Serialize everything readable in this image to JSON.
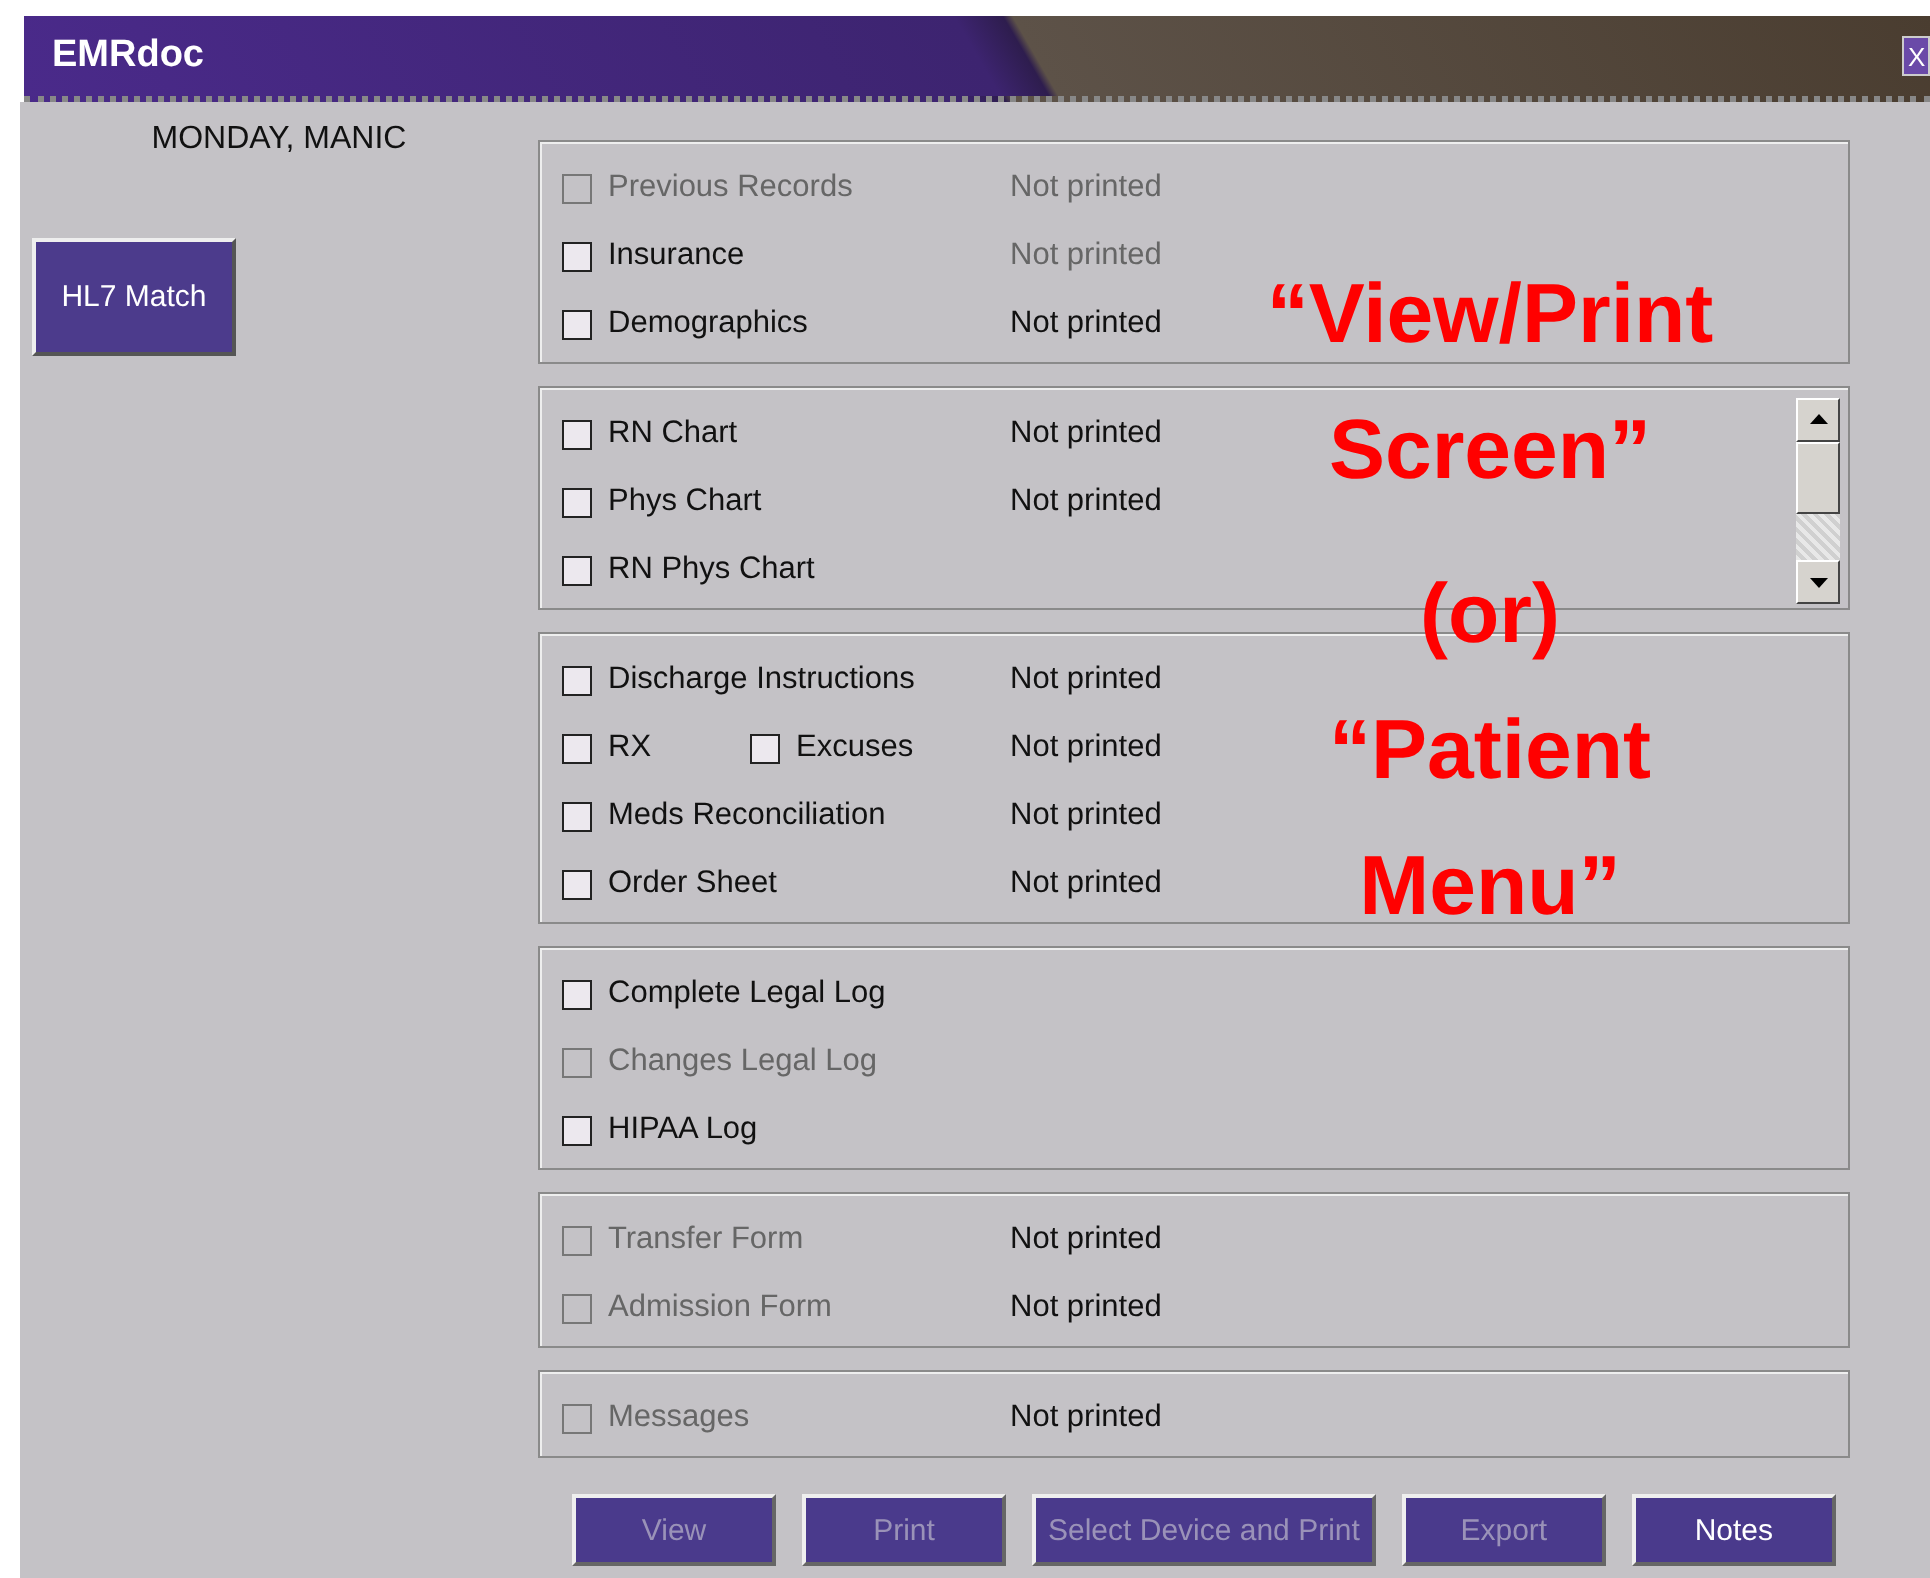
{
  "window": {
    "title": "EMRdoc",
    "close": "X"
  },
  "patient": "MONDAY, MANIC",
  "hl7_button": "HL7 Match",
  "groups": [
    {
      "scroll": false,
      "rows": [
        {
          "items": [
            {
              "label": "Previous Records",
              "checked": false,
              "disabled": true
            }
          ],
          "status": {
            "text": "Not printed",
            "disabled": true
          }
        },
        {
          "items": [
            {
              "label": "Insurance",
              "checked": false,
              "disabled": false
            }
          ],
          "status": {
            "text": "Not printed",
            "disabled": true
          }
        },
        {
          "items": [
            {
              "label": "Demographics",
              "checked": false,
              "disabled": false
            }
          ],
          "status": {
            "text": "Not printed",
            "disabled": false
          }
        }
      ]
    },
    {
      "scroll": true,
      "rows": [
        {
          "items": [
            {
              "label": "RN Chart",
              "checked": false,
              "disabled": false
            }
          ],
          "status": {
            "text": "Not printed",
            "disabled": false
          }
        },
        {
          "items": [
            {
              "label": "Phys Chart",
              "checked": false,
              "disabled": false
            }
          ],
          "status": {
            "text": "Not printed",
            "disabled": false
          }
        },
        {
          "items": [
            {
              "label": "RN  Phys Chart",
              "checked": false,
              "disabled": false
            }
          ]
        }
      ]
    },
    {
      "scroll": false,
      "rows": [
        {
          "items": [
            {
              "label": "Discharge Instructions",
              "checked": false,
              "disabled": false
            }
          ],
          "status": {
            "text": "Not printed",
            "disabled": false
          }
        },
        {
          "items": [
            {
              "label": "RX",
              "checked": false,
              "disabled": false
            },
            {
              "label": "Excuses",
              "checked": false,
              "disabled": false
            }
          ],
          "status": {
            "text": "Not printed",
            "disabled": false
          }
        },
        {
          "items": [
            {
              "label": "Meds Reconciliation",
              "checked": false,
              "disabled": false
            }
          ],
          "status": {
            "text": "Not printed",
            "disabled": false
          }
        },
        {
          "items": [
            {
              "label": "Order Sheet",
              "checked": false,
              "disabled": false
            }
          ],
          "status": {
            "text": "Not printed",
            "disabled": false
          }
        }
      ]
    },
    {
      "scroll": false,
      "rows": [
        {
          "items": [
            {
              "label": "Complete Legal Log",
              "checked": false,
              "disabled": false
            }
          ]
        },
        {
          "items": [
            {
              "label": "Changes Legal Log",
              "checked": false,
              "disabled": true
            }
          ]
        },
        {
          "items": [
            {
              "label": "HIPAA Log",
              "checked": false,
              "disabled": false
            }
          ]
        }
      ]
    },
    {
      "scroll": false,
      "rows": [
        {
          "items": [
            {
              "label": "Transfer Form",
              "checked": false,
              "disabled": true
            }
          ],
          "status": {
            "text": "Not printed",
            "disabled": false
          }
        },
        {
          "items": [
            {
              "label": "Admission Form",
              "checked": false,
              "disabled": true
            }
          ],
          "status": {
            "text": "Not printed",
            "disabled": false
          }
        }
      ]
    },
    {
      "scroll": false,
      "rows": [
        {
          "items": [
            {
              "label": "Messages",
              "checked": false,
              "disabled": true
            }
          ],
          "status": {
            "text": "Not printed",
            "disabled": false
          }
        }
      ]
    }
  ],
  "buttons": [
    {
      "label": "View",
      "disabled": true
    },
    {
      "label": "Print",
      "disabled": true
    },
    {
      "label": "Select Device and Print",
      "disabled": true
    },
    {
      "label": "Export",
      "disabled": true
    },
    {
      "label": "Notes",
      "disabled": false
    }
  ],
  "annotation": [
    "“View/Print",
    "Screen”",
    "(or)",
    "“Patient",
    "Menu”"
  ]
}
